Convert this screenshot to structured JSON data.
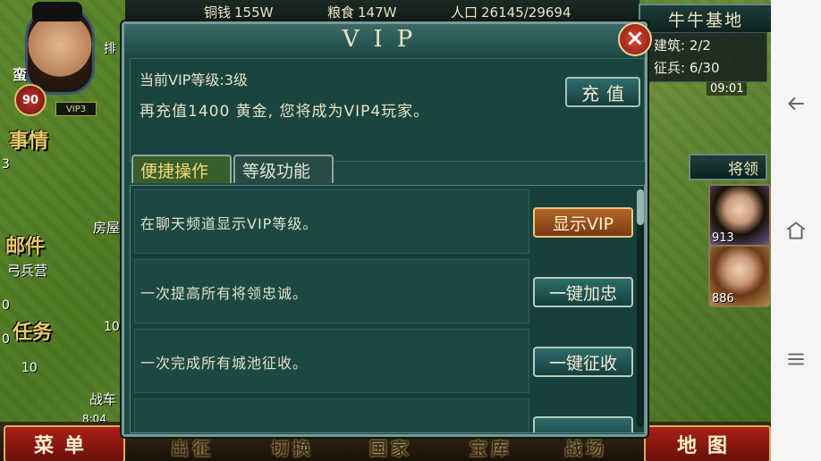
{
  "resources": {
    "copper_label": "铜钱",
    "copper_value": "155W",
    "grain_label": "粮食",
    "grain_value": "147W",
    "population_label": "人口",
    "population_value": "26145/29694"
  },
  "player": {
    "name": "蛮",
    "level": "90",
    "vip_badge": "VIP3",
    "rank_partial": "排"
  },
  "city": {
    "name": "牛牛基地",
    "buildings": "建筑: 2/2",
    "recruits": "征兵: 6/30",
    "clock": "09:01"
  },
  "generals_button": "将领",
  "heroes": [
    {
      "value": "913"
    },
    {
      "value": "886"
    }
  ],
  "side": {
    "event_label": "事情",
    "mail_label": "邮件",
    "barracks_label": "弓兵营",
    "task_label": "任务",
    "house_label": "房屋",
    "chariot_label": "战车",
    "count_3": "3",
    "count_0a": "0",
    "count_0b": "0",
    "count_10a": "10",
    "count_10b": "10",
    "time": "8:04"
  },
  "dialog": {
    "title": "VIP",
    "current_level": "当前VIP等级:3级",
    "hint": "再充值1400 黄金, 您将成为VIP4玩家。",
    "recharge_button": "充值",
    "tabs": [
      {
        "label": "便捷操作",
        "active": true
      },
      {
        "label": "等级功能",
        "active": false
      }
    ],
    "rows": [
      {
        "desc": "在聊天频道显示VIP等级。",
        "button": "显示VIP",
        "style": "orange"
      },
      {
        "desc": "一次提高所有将领忠诚。",
        "button": "一键加忠",
        "style": "teal"
      },
      {
        "desc": "一次完成所有城池征收。",
        "button": "一键征收",
        "style": "teal"
      },
      {
        "desc": "",
        "button": "",
        "style": "teal"
      }
    ],
    "scroll_position": 0.0
  },
  "bottom_menu": {
    "menu": "菜单",
    "map": "地图",
    "items": [
      "出征",
      "切换",
      "国家",
      "宝库",
      "战场"
    ]
  },
  "colors": {
    "dialog_bg": "#1e4a46",
    "accent_gold": "#f4d87a",
    "button_red": "#a92015"
  }
}
